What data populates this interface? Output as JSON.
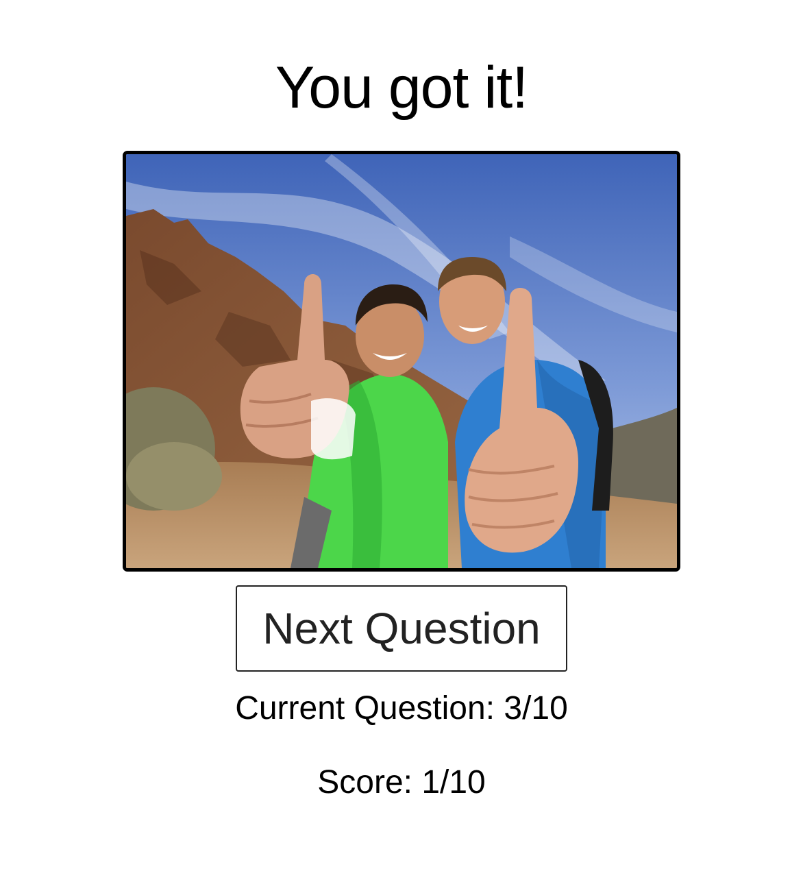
{
  "result": {
    "title": "You got it!"
  },
  "image": {
    "alt": "Two hikers smiling and giving thumbs up on a rocky mountain trail"
  },
  "actions": {
    "next_label": "Next Question"
  },
  "progress": {
    "current_label": "Current Question: 3/10",
    "current": 3,
    "total": 10
  },
  "score": {
    "label": "Score: 1/10",
    "value": 1,
    "total": 10
  }
}
